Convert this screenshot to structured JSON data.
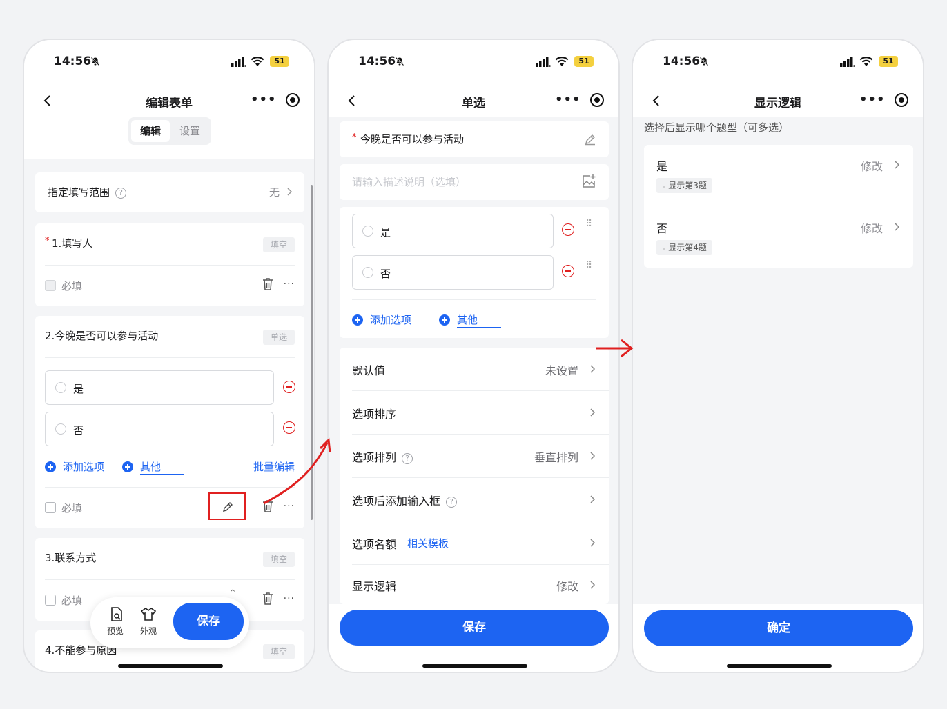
{
  "status": {
    "time": "14:56",
    "battery": "51"
  },
  "screen1": {
    "title": "编辑表单",
    "seg": {
      "edit": "编辑",
      "settings": "设置"
    },
    "scope": {
      "label": "指定填写范围",
      "help": "?",
      "value": "无"
    },
    "q1": {
      "asterisk": "*",
      "title": "1.填写人",
      "tag": "填空",
      "required": "必填"
    },
    "q2": {
      "title": "2.今晚是否可以参与活动",
      "tag": "单选",
      "opt1": "是",
      "opt2": "否",
      "add_option": "添加选项",
      "other": "其他",
      "batch": "批量编辑",
      "required": "必填"
    },
    "q3": {
      "title": "3.联系方式",
      "tag": "填空",
      "required": "必填"
    },
    "q4": {
      "title": "4.不能参与原因",
      "tag": "填空"
    },
    "toolbar": {
      "preview": "预览",
      "appearance": "外观",
      "save": "保存"
    }
  },
  "screen2": {
    "title": "单选",
    "question": {
      "asterisk": "*",
      "title": "今晚是否可以参与活动",
      "desc_placeholder": "请输入描述说明（选填）"
    },
    "opt1": "是",
    "opt2": "否",
    "add_option": "添加选项",
    "other": "其他",
    "rows": {
      "default": {
        "label": "默认值",
        "value": "未设置"
      },
      "sort": {
        "label": "选项排序"
      },
      "layout": {
        "label": "选项排列",
        "help": "?",
        "value": "垂直排列"
      },
      "input": {
        "label": "选项后添加输入框",
        "help": "?"
      },
      "quota": {
        "label": "选项名额",
        "link": "相关模板"
      },
      "logic": {
        "label": "显示逻辑",
        "value": "修改"
      }
    },
    "save": "保存"
  },
  "screen3": {
    "title": "显示逻辑",
    "hint": "选择后显示哪个题型（可多选）",
    "items": [
      {
        "label": "是",
        "action": "修改",
        "tag": "显示第3题"
      },
      {
        "label": "否",
        "action": "修改",
        "tag": "显示第4题"
      }
    ],
    "confirm": "确定"
  },
  "colors": {
    "primary": "#1d64f2",
    "danger": "#e02020",
    "annotation": "#e02020"
  }
}
